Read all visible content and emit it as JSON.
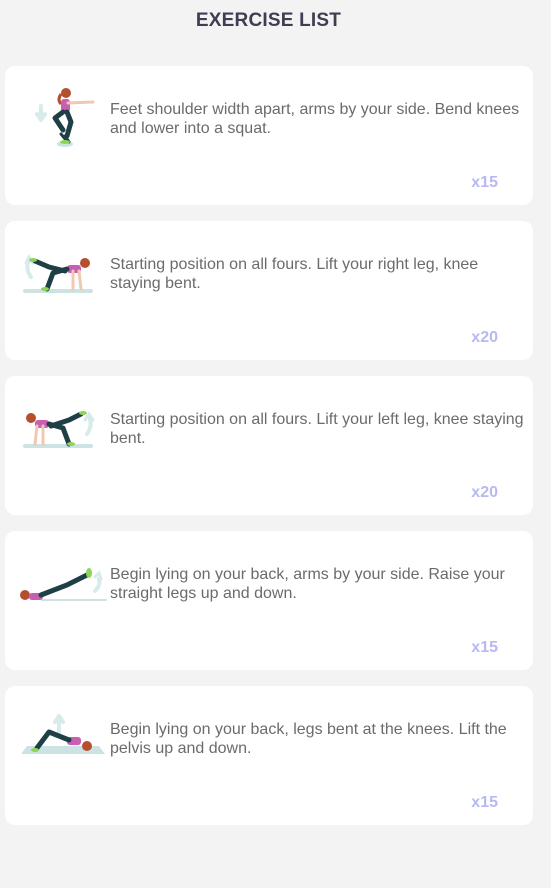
{
  "header": {
    "title": "EXERCISE LIST"
  },
  "exercises": [
    {
      "icon": "squat-icon",
      "description": "Feet shoulder width apart, arms by your side. Bend knees and lower into a squat.",
      "reps": "x15"
    },
    {
      "icon": "right-leg-kickback-icon",
      "description": "Starting position on all fours. Lift your right leg, knee staying bent.",
      "reps": "x20"
    },
    {
      "icon": "left-leg-kickback-icon",
      "description": "Starting position on all fours. Lift your left leg, knee staying bent.",
      "reps": "x20"
    },
    {
      "icon": "leg-raise-icon",
      "description": "Begin lying on your back, arms by your side. Raise your straight legs up and down.",
      "reps": "x15"
    },
    {
      "icon": "glute-bridge-icon",
      "description": "Begin lying on your back, legs bent at the knees. Lift the pelvis up and down.",
      "reps": "x15"
    }
  ],
  "colors": {
    "background": "#f3f3f4",
    "card": "#ffffff",
    "title": "#3f3d4f",
    "description": "#6b6b6b",
    "reps": "#b7b8f4",
    "hair": "#b5502f",
    "top": "#c85fb0",
    "pants": "#1f3f47",
    "shoes": "#8ed35a",
    "mat": "#cde3e3",
    "arrow": "#d7ebeb"
  }
}
